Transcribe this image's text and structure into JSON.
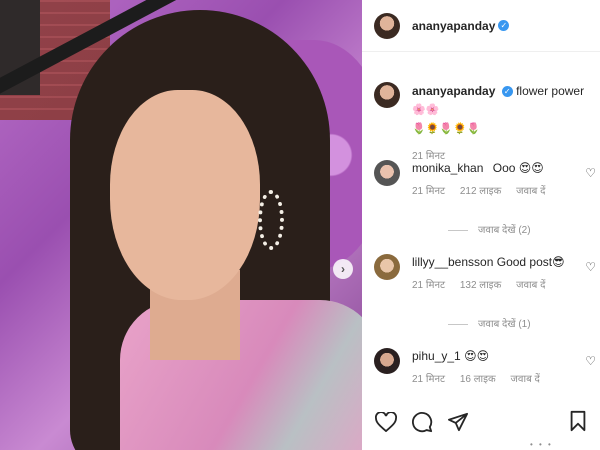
{
  "post": {
    "username": "ananyapanday",
    "caption_text": "flower power",
    "caption_emojis_1": "🌸🌸",
    "caption_emojis_2": "🌷🌻🌷🌻🌷",
    "time": "21 मिनट"
  },
  "carousel": {
    "next_label": "›"
  },
  "comments": [
    {
      "username": "monika_khan",
      "text": "Ooo 😍😍",
      "time": "21 मिनट",
      "likes": "212 लाइक",
      "reply": "जवाब दें",
      "replies_text": "जवाब देखें (2)"
    },
    {
      "username": "lillyy__bensson",
      "text": "Good post😎",
      "time": "21 मिनट",
      "likes": "132 लाइक",
      "reply": "जवाब दें",
      "replies_text": "जवाब देखें (1)"
    },
    {
      "username": "pihu_y_1",
      "text": "😍😍",
      "time": "21 मिनट",
      "likes": "16 लाइक",
      "reply": "जवाब दें"
    }
  ]
}
